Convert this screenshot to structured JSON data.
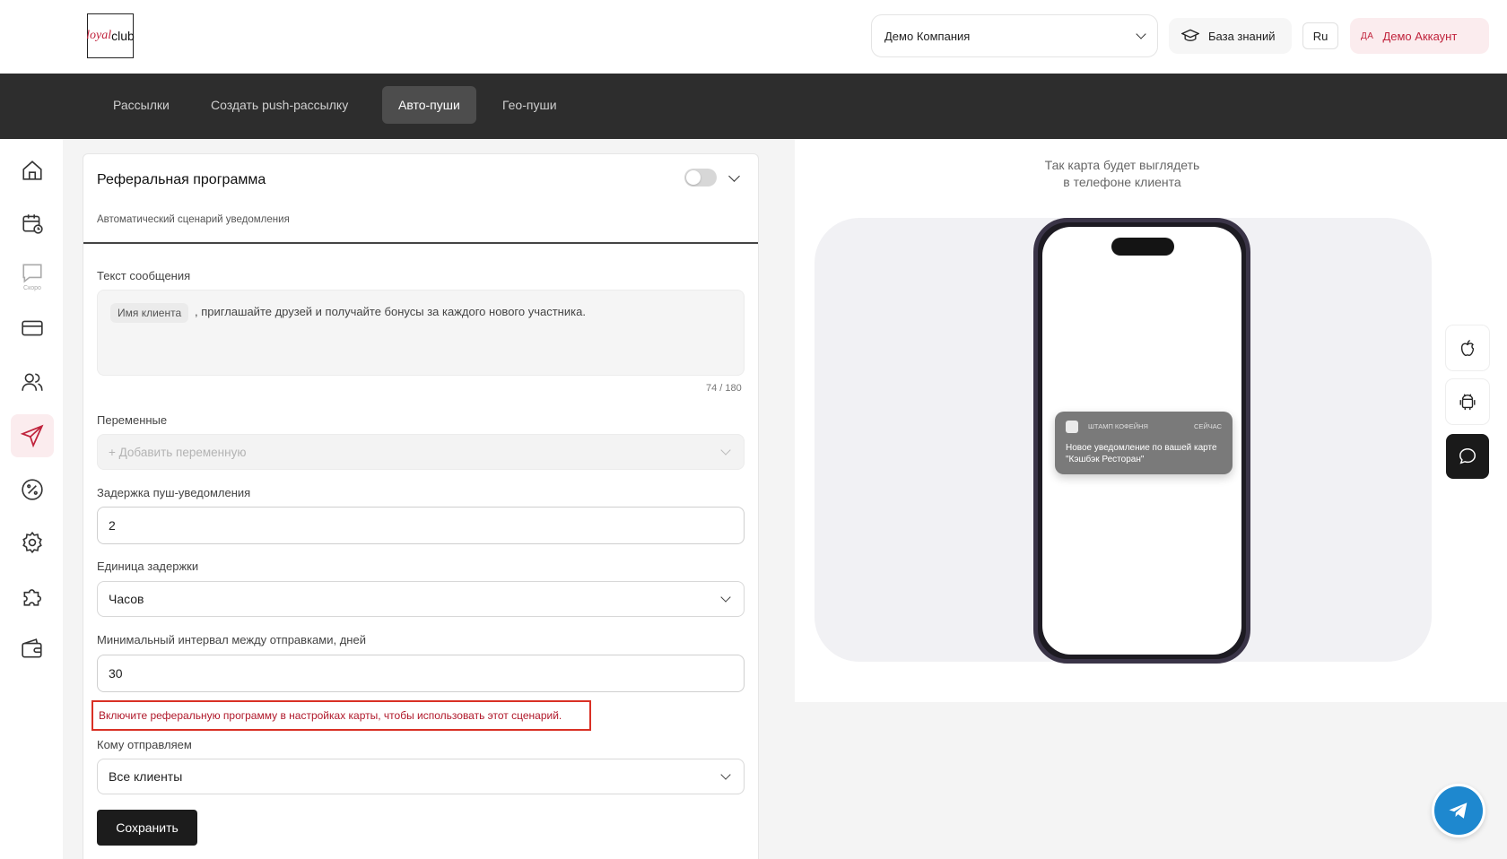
{
  "header": {
    "logo": {
      "loyal": "loyal",
      "club": "club"
    },
    "company": "Демо Компания",
    "knowledge_base": "База знаний",
    "lang": "Ru",
    "account_initials": "ДА",
    "account_name": "Демо Аккаунт"
  },
  "tabs": [
    {
      "label": "Рассылки",
      "active": false
    },
    {
      "label": "Создать push-рассылку",
      "active": false
    },
    {
      "label": "Авто-пуши",
      "active": true
    },
    {
      "label": "Гео-пуши",
      "active": false
    }
  ],
  "sidebar": {
    "items": [
      {
        "icon": "home-icon"
      },
      {
        "icon": "calendar-icon"
      },
      {
        "icon": "chat-icon",
        "badge": "Скоро"
      },
      {
        "icon": "card-icon"
      },
      {
        "icon": "users-icon"
      },
      {
        "icon": "send-icon",
        "active": true
      },
      {
        "icon": "percent-icon"
      },
      {
        "icon": "gear-icon"
      },
      {
        "icon": "puzzle-icon"
      },
      {
        "icon": "wallet-icon"
      }
    ]
  },
  "form": {
    "title": "Реферальная программа",
    "subtitle": "Автоматический сценарий уведомления",
    "enabled": false,
    "message_label": "Текст сообщения",
    "message_chip": "Имя клиента",
    "message_text": ", приглашайте друзей и получайте бонусы за каждого нового участника.",
    "counter": "74 / 180",
    "variables_label": "Переменные",
    "variables_placeholder": "+ Добавить переменную",
    "delay_label": "Задержка пуш-уведомления",
    "delay_value": "2",
    "unit_label": "Единица задержки",
    "unit_value": "Часов",
    "interval_label": "Минимальный интервал между отправками, дней",
    "interval_value": "30",
    "warning": "Включите реферальную программу в настройках карты, чтобы использовать этот сценарий.",
    "audience_label": "Кому отправляем",
    "audience_value": "Все клиенты",
    "save_label": "Сохранить"
  },
  "preview": {
    "title_line1": "Так карта будет выглядеть",
    "title_line2": "в телефоне клиента",
    "notification": {
      "app_name": "ШТАМП КОФЕЙНЯ",
      "time": "СЕЙЧАС",
      "body": "Новое уведомление по вашей карте \"Кэшбэк Ресторан\""
    }
  },
  "os_switch": [
    {
      "icon": "apple-icon",
      "active": false
    },
    {
      "icon": "android-icon",
      "active": false
    },
    {
      "icon": "message-icon",
      "active": true
    }
  ],
  "colors": {
    "accent": "#c0233c",
    "dark_bar": "#2d2d2d",
    "telegram": "#1e88cf"
  }
}
